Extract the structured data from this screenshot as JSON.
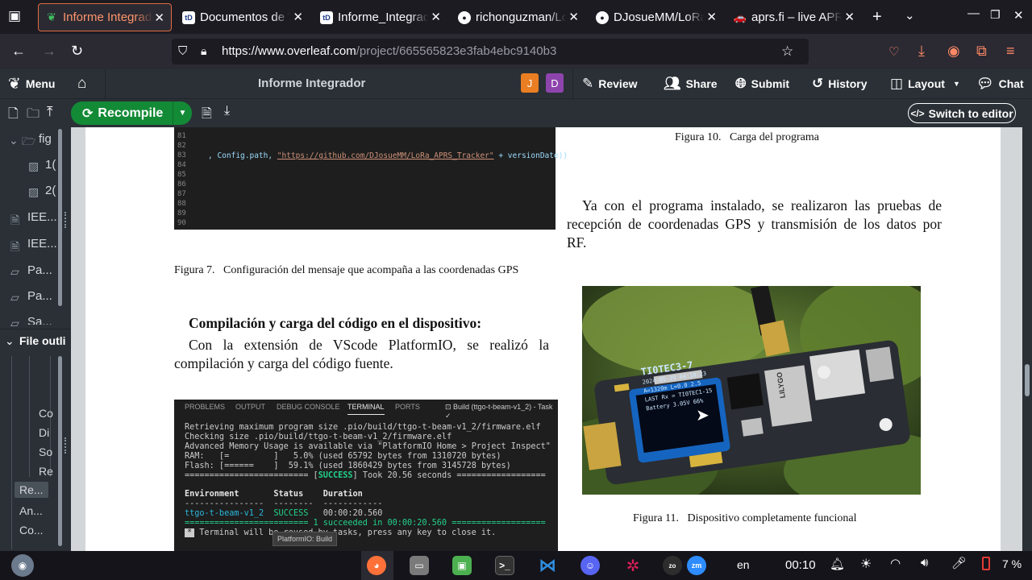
{
  "tabs": [
    {
      "title": "Informe Integrador",
      "active": true,
      "icon": "overleaf-icon"
    },
    {
      "title": "Documentos de Tecnología",
      "active": false,
      "icon": "td-icon"
    },
    {
      "title": "Informe_Integrador",
      "active": false,
      "icon": "td-icon"
    },
    {
      "title": "richonguzman/LoRa",
      "active": false,
      "icon": "github-icon"
    },
    {
      "title": "DJosueMM/LoRa_APRS",
      "active": false,
      "icon": "github-icon"
    },
    {
      "title": "aprs.fi – live APRS",
      "active": false,
      "icon": "car-icon"
    }
  ],
  "url": {
    "domain": "https://www.overleaf.com",
    "path": "/project/665565823e3fab4ebc9140b3"
  },
  "header": {
    "menu_label": "Menu",
    "project_title": "Informe Integrador",
    "avatars": [
      {
        "letter": "J",
        "color": "#e97e22"
      },
      {
        "letter": "D",
        "color": "#8e44ad"
      }
    ],
    "review_label": "Review",
    "share_label": "Share",
    "submit_label": "Submit",
    "history_label": "History",
    "layout_label": "Layout",
    "chat_label": "Chat"
  },
  "toolbar": {
    "recompile_label": "Recompile",
    "switch_label": "Switch to editor"
  },
  "sidebar": {
    "files": [
      {
        "label": "fig",
        "kind": "folder"
      },
      {
        "label": "1(",
        "kind": "image"
      },
      {
        "label": "2(",
        "kind": "image"
      },
      {
        "label": "IEE...",
        "kind": "file"
      },
      {
        "label": "IEE...",
        "kind": "file"
      },
      {
        "label": "Pa...",
        "kind": "file"
      },
      {
        "label": "Pa...",
        "kind": "file"
      },
      {
        "label": "Sa...",
        "kind": "file"
      }
    ],
    "outline_label": "File outli",
    "outline_items": [
      "Co",
      "Di",
      "So",
      "Re",
      "Re...",
      "An...",
      "Co..."
    ]
  },
  "document": {
    "code_lines": [
      "81",
      "82",
      "83",
      "84",
      "85",
      "86",
      "87",
      "88",
      "89",
      "90"
    ],
    "code_text_a": ", Config.path, ",
    "code_text_url": "\"https://github.com/DJosueMM/LoRa_APRS_Tracker\"",
    "code_text_b": " + versionDate))",
    "fig10_caption": "Figura 10.   Carga del programa",
    "fig7_caption": "Figura 7.   Configuración del mensaje que acompaña a las coordenadas GPS",
    "section_heading": "Compilación y carga del código en el dispositivo:",
    "para_left_1": "Con la extensión de VScode PlatformIO, se realizó la",
    "para_left_2": "compilación y carga del código fuente.",
    "para_right_1": "Ya con el programa instalado, se realizaron las pruebas de",
    "para_right_2": "recepción de coordenadas GPS y transmisión de los datos por",
    "para_right_3": "RF.",
    "fig11_caption": "Figura 11.   Dispositivo completamente funcional"
  },
  "terminal": {
    "tabs": [
      "PROBLEMS",
      "OUTPUT",
      "DEBUG CONSOLE",
      "TERMINAL",
      "PORTS"
    ],
    "task_label": "Build (ttgo-t-beam-v1_2) - Task",
    "lines": [
      "Retrieving maximum program size .pio/build/ttgo-t-beam-v1_2/firmware.elf",
      "Checking size .pio/build/ttgo-t-beam-v1_2/firmware.elf",
      "Advanced Memory Usage is available via \"PlatformIO Home > Project Inspect\"",
      "RAM:   [=         ]   5.0% (used 65792 bytes from 1310720 bytes)",
      "Flash: [======    ]  59.1% (used 1860429 bytes from 3145728 bytes)"
    ],
    "success_prefix": "========================= [",
    "success_word": "SUCCESS",
    "success_suffix": "] Took 20.56 seconds ==================",
    "header_row": "Environment       Status    Duration",
    "sep_row": "----------------  --------  ------------",
    "env": "ttgo-t-beam-v1_2",
    "status": "SUCCESS",
    "duration": "00:00:20.560",
    "summary": "========================= 1 succeeded in 00:00:20.560 ===================",
    "reuse": " Terminal will be reused by tasks, press any key to close it.",
    "tooltip": "PlatformIO: Build"
  },
  "oled": {
    "line1": "TI0TEC3-7",
    "line2": "2024-05-29  04:10:23",
    "line3": "A=1320m   L=0.0  2.5",
    "line4": "LAST Rx = TI0TEC1-15",
    "line5": "Battery  3.05V   66%"
  },
  "board_label": "LILYGO",
  "taskbar": {
    "lang": "en",
    "time": "00:10",
    "battery": "7 %"
  },
  "colors": {
    "accent": "#e06c3e",
    "overleaf_green": "#138a36",
    "terminal_bg": "#1e1e1e"
  }
}
